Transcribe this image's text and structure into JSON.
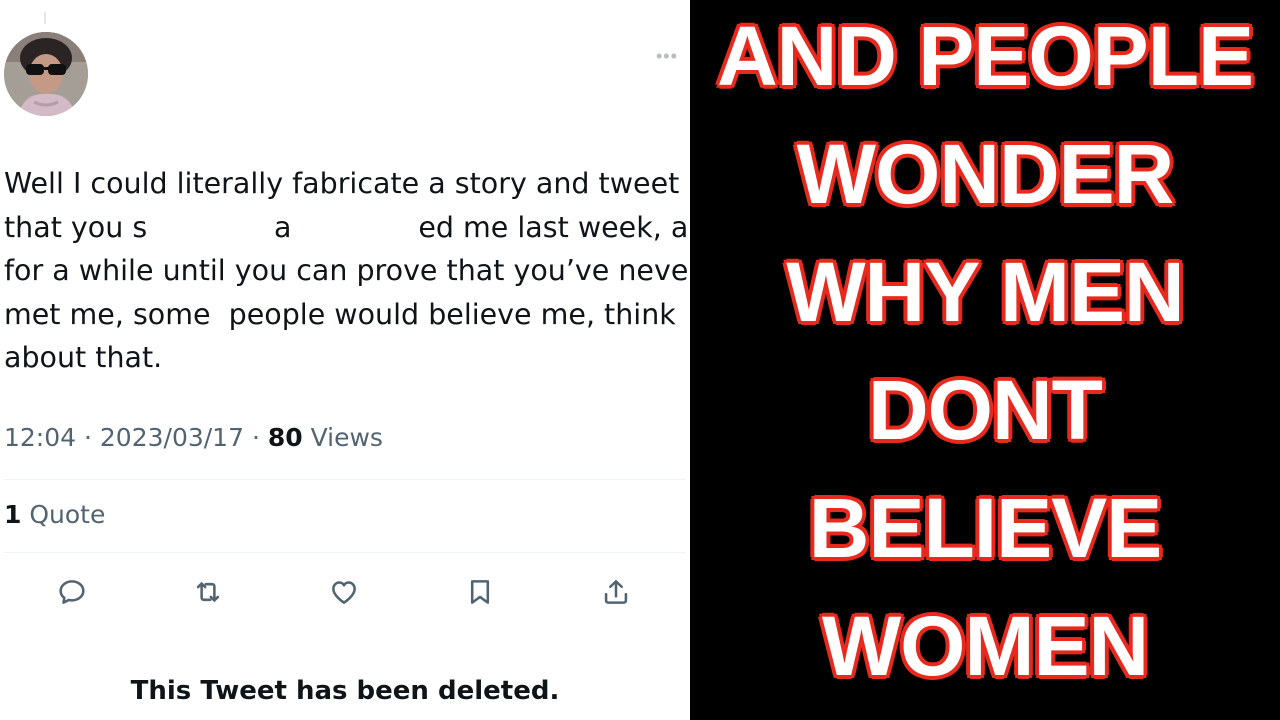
{
  "tweet": {
    "text_lines": [
      "Well I could literally fabricate a story and tweet",
      "that you s              a              ed me last week, and",
      "for a while until you can prove that you’ve never",
      "met me, some  people would believe me, think",
      "about that."
    ],
    "time": "12:04",
    "date": "2023/03/17",
    "views_count": "80",
    "views_label": "Views",
    "quote_count": "1",
    "quote_label": "Quote",
    "deleted_notice": "This Tweet has been deleted."
  },
  "actions": [
    {
      "icon": "reply-icon"
    },
    {
      "icon": "retweet-icon"
    },
    {
      "icon": "like-icon"
    },
    {
      "icon": "bookmark-icon"
    },
    {
      "icon": "share-icon"
    }
  ],
  "caption": {
    "lines": [
      "AND PEOPLE",
      "WONDER",
      "WHY MEN",
      "DONT",
      "BELIEVE",
      "WOMEN"
    ]
  },
  "colors": {
    "caption_fill": "#ffffff",
    "caption_outline": "#e8291d",
    "caption_background": "#000000",
    "tweet_text": "#0f1419",
    "tweet_secondary": "#536471"
  }
}
